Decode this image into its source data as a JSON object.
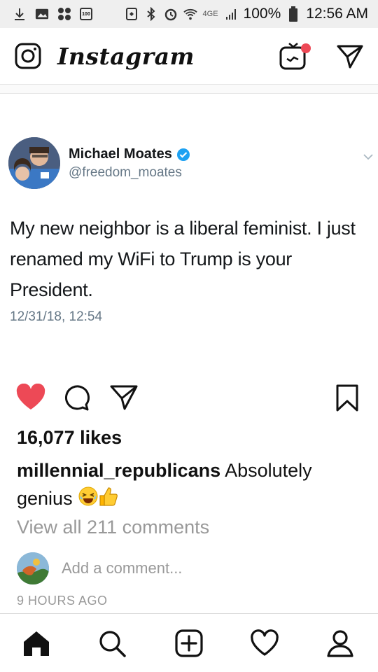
{
  "status_bar": {
    "network": "4GE",
    "battery": "100%",
    "time": "12:56 AM",
    "left_badge": "100"
  },
  "header": {
    "logo": "Instagram",
    "camera_icon": "camera-icon",
    "igtv_icon": "igtv-icon",
    "direct_icon": "direct-message-icon",
    "notification_dot_color": "#ed4956"
  },
  "tweet": {
    "name": "Michael Moates",
    "handle": "@freedom_moates",
    "text": "My new neighbor is a liberal feminist. I just renamed my WiFi to Trump is your President.",
    "date": "12/31/18, 12:54",
    "verified_color": "#1da1f2"
  },
  "actions": {
    "like_icon": "heart-filled-icon",
    "like_color": "#ed4956",
    "comment_icon": "comment-icon",
    "share_icon": "share-icon",
    "save_icon": "bookmark-icon"
  },
  "post": {
    "likes": "16,077 likes",
    "caption_user": "millennial_republicans",
    "caption_text": "Absolutely genius",
    "caption_emojis": "😂👍",
    "view_comments": "View all 211 comments",
    "add_comment_placeholder": "Add a comment...",
    "time_ago": "9 HOURS AGO"
  },
  "bottom_nav": {
    "items": [
      "home-icon",
      "search-icon",
      "add-post-icon",
      "activity-heart-icon",
      "profile-icon"
    ]
  }
}
